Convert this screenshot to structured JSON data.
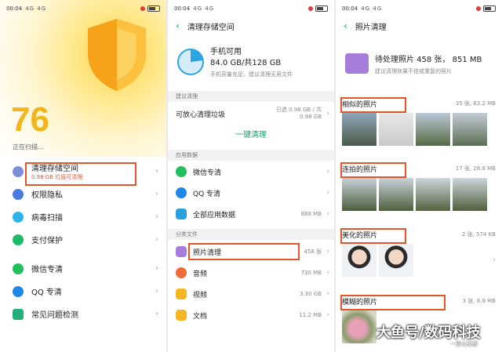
{
  "status": {
    "time": "00:04",
    "signal": "4G 4G"
  },
  "screen1": {
    "score": "76",
    "scanning": "正在扫描...",
    "items": [
      {
        "label": "清理存储空间",
        "sub": "0.98 GB 垃圾可清理",
        "color": "#7b8fd6"
      },
      {
        "label": "权限隐私",
        "sub": "",
        "color": "#4a7be0"
      },
      {
        "label": "病毒扫描",
        "sub": "",
        "color": "#2fb3e8"
      },
      {
        "label": "支付保护",
        "sub": "",
        "color": "#1fb96a"
      },
      {
        "label": "微信专清",
        "sub": "",
        "color": "#22c05a"
      },
      {
        "label": "QQ 专清",
        "sub": "",
        "color": "#1e88e5"
      },
      {
        "label": "常见问题检测",
        "sub": "",
        "color": "#23b07a"
      }
    ]
  },
  "screen2": {
    "title": "清理存储空间",
    "phone_label": "手机可用",
    "phone_value": "84.0 GB/共128 GB",
    "phone_hint": "手机容量充足，建议清理无用文件",
    "section_suggest": "建议清理",
    "safe_clean": "可放心清理垃圾",
    "safe_clean_value": "已选 0.98 GB / 共 0.98 GB",
    "one_click": "一键清理",
    "section_app": "应用数据",
    "apps": [
      {
        "label": "微信专清",
        "value": "",
        "color": "#22c05a"
      },
      {
        "label": "QQ 专清",
        "value": "",
        "color": "#1e88e5"
      },
      {
        "label": "全部应用数据",
        "value": "888 MB",
        "color": "#2a9fe0"
      }
    ],
    "section_files": "分类文件",
    "files": [
      {
        "label": "照片清理",
        "value": "458 张",
        "color": "#a77ddc"
      },
      {
        "label": "音频",
        "value": "730 MB",
        "color": "#f06a3a"
      },
      {
        "label": "视频",
        "value": "3.30 GB",
        "color": "#f4b622"
      },
      {
        "label": "文档",
        "value": "11.2 MB",
        "color": "#f4b622"
      }
    ]
  },
  "screen3": {
    "title": "照片清理",
    "pending": "待处理照片 458 张， 851 MB",
    "pending_hint": "建议清理效果不佳或重复的照片",
    "categories": [
      {
        "label": "相似的照片",
        "meta": "35 张, 63.2 MB"
      },
      {
        "label": "连拍的照片",
        "meta": "17 张, 28.8 MB"
      },
      {
        "label": "美化的照片",
        "meta": "2 张, 574 KB"
      },
      {
        "label": "模糊的照片",
        "meta": "3 张, 8.9 MB"
      }
    ]
  },
  "watermark": "大鱼号/数码科技",
  "watermark_small": "一直以来都"
}
